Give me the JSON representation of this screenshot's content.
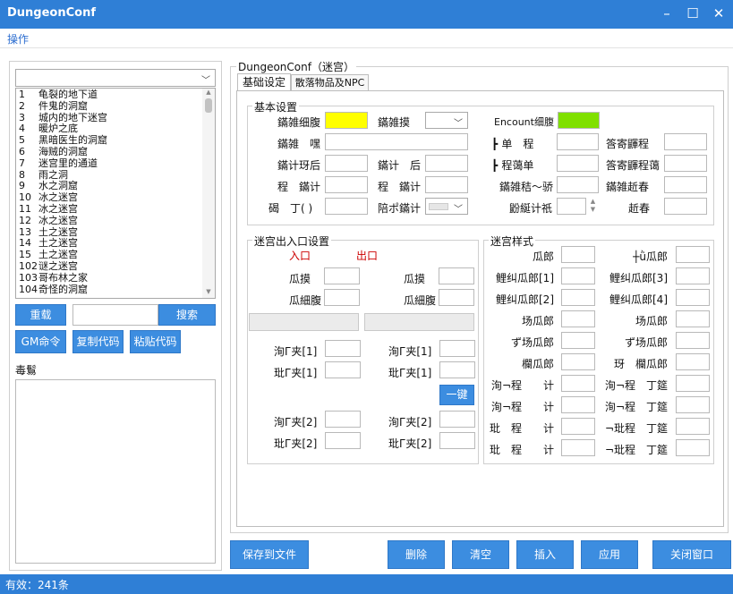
{
  "window": {
    "title": "DungeonConf"
  },
  "menu": {
    "item1": "操作"
  },
  "left": {
    "list_items": [
      {
        "n": "1",
        "name": "龟裂的地下道"
      },
      {
        "n": "2",
        "name": "件鬼的洞窟"
      },
      {
        "n": "3",
        "name": "城内的地下迷宫"
      },
      {
        "n": "4",
        "name": "暖炉之底"
      },
      {
        "n": "5",
        "name": "黑暗医生的洞窟"
      },
      {
        "n": "6",
        "name": "海贼的洞窟"
      },
      {
        "n": "7",
        "name": "迷宫里的通道"
      },
      {
        "n": "8",
        "name": "雨之洞"
      },
      {
        "n": "9",
        "name": "水之洞窟"
      },
      {
        "n": "10",
        "name": "冰之迷宫"
      },
      {
        "n": "11",
        "name": "冰之迷宫"
      },
      {
        "n": "12",
        "name": "冰之迷宫"
      },
      {
        "n": "13",
        "name": "土之迷宫"
      },
      {
        "n": "14",
        "name": "土之迷宫"
      },
      {
        "n": "15",
        "name": "土之迷宫"
      },
      {
        "n": "102",
        "name": "谜之迷宫"
      },
      {
        "n": "103",
        "name": "哥布林之家"
      },
      {
        "n": "104",
        "name": "奇怪的洞窟"
      }
    ],
    "btn_reload": "重载",
    "btn_search": "搜索",
    "btn_gm": "GM命令",
    "btn_copy": "复制代码",
    "btn_paste": "粘贴代码",
    "notes_label": "毒鬄"
  },
  "right": {
    "group_title": "DungeonConf（迷宫）",
    "tab1": "基础设定",
    "tab2": "散落物品及NPC",
    "basic": {
      "title": "基本设置",
      "l_r1c1": "鏋雑细腹",
      "l_r1c2": "鏋雑摸",
      "l_r1c3": "Encount细腹",
      "l_r2c1": "鏋雑　嘿",
      "l_r2c3a": "单　程",
      "l_r2c3b": "筨寄鼲程",
      "l_r3c1": "鏋计玡后",
      "l_r3c2": "鏋计　后",
      "l_r3c3a": "程蔼单",
      "l_r3c3b": "筨寄鼲程蔼",
      "l_r4c1": "程　鏋计",
      "l_r4c2": "程　鏋计",
      "l_r4c3a": "鏋雑秸～骄",
      "l_r4c3b": "鏋雑赾春",
      "l_r5c1": "碣　丁(  )",
      "l_r5c2": "陪ポ鏋计",
      "l_r5c3a": "鼢綖计祇",
      "l_r5c3b": "赾春",
      "color_yellow": "#ffff00",
      "color_green": "#80e000"
    },
    "entrance": {
      "title": "迷宫出入口设置",
      "in": "入口",
      "out": "出口",
      "mo": "瓜摸",
      "fu": "瓜細腹",
      "p1": "洵Г夹[1]",
      "q1": "玭Г夹[1]",
      "btn_one": "一键",
      "p2": "洵Г夹[2]",
      "q2": "玭Г夹[2]",
      "accent": "#cc0000"
    },
    "style": {
      "title": "迷宫样式",
      "rows": [
        [
          "瓜郎",
          "┼ǜ瓜郎"
        ],
        [
          "鲤纠瓜郎[1]",
          "鲤纠瓜郎[3]"
        ],
        [
          "鲤纠瓜郎[2]",
          "鲤纠瓜郎[4]"
        ],
        [
          "场瓜郎",
          "场瓜郎"
        ],
        [
          "ず场瓜郎",
          "ず场瓜郎"
        ],
        [
          "欄瓜郎",
          "玡　欄瓜郎"
        ],
        [
          "洵¬程　　计",
          "洵¬程　丁筵"
        ],
        [
          "洵¬程　　计",
          "洵¬程　丁筵"
        ],
        [
          "玭　程　　计",
          "¬玭程　丁筵"
        ],
        [
          "玭　程　　计",
          "¬玭程　丁筵"
        ]
      ]
    },
    "buttons": {
      "save": "保存到文件",
      "delete": "删除",
      "clear": "清空",
      "insert": "插入",
      "apply": "应用",
      "close": "关闭窗口"
    }
  },
  "status": {
    "text": "有效：241条"
  }
}
